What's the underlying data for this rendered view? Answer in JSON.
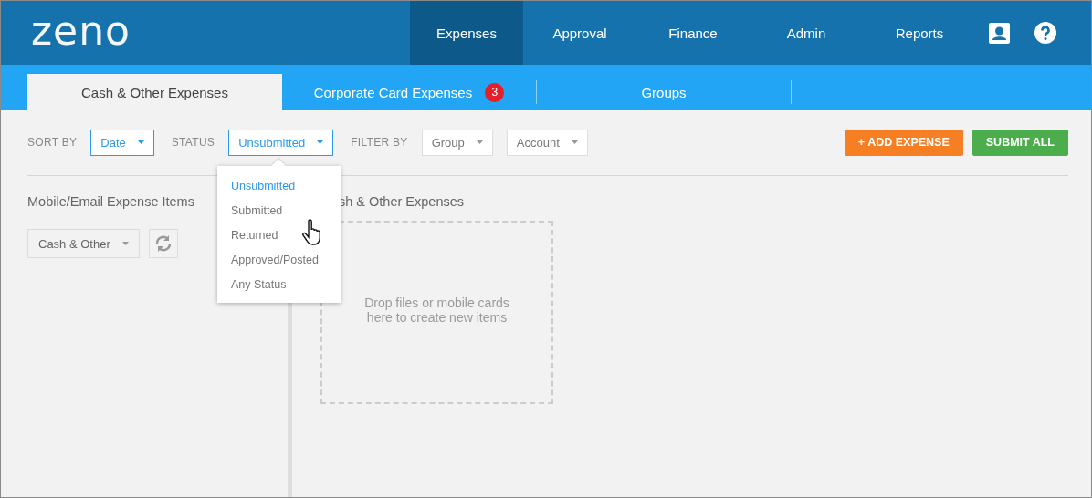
{
  "logo": "zeno",
  "nav": [
    {
      "label": "Expenses",
      "selected": true
    },
    {
      "label": "Approval",
      "selected": false
    },
    {
      "label": "Finance",
      "selected": false
    },
    {
      "label": "Admin",
      "selected": false
    },
    {
      "label": "Reports",
      "selected": false
    }
  ],
  "tabs": [
    {
      "label": "Cash & Other Expenses",
      "selected": true
    },
    {
      "label": "Corporate Card Expenses",
      "selected": false,
      "badge": "3"
    },
    {
      "label": "Groups",
      "selected": false
    }
  ],
  "toolbar": {
    "sort_label": "SORT BY",
    "sort_value": "Date",
    "status_label": "STATUS",
    "status_value": "Unsubmitted",
    "status_expanded": true,
    "filter_label": "FILTER BY",
    "filters": [
      "Group",
      "Account"
    ],
    "buttons": [
      {
        "label": "+ ADD EXPENSE",
        "kind": "add"
      },
      {
        "label": "SUBMIT ALL",
        "kind": "submit"
      }
    ]
  },
  "status_menu": [
    {
      "label": "Unsubmitted",
      "selected": true
    },
    {
      "label": "Submitted",
      "selected": false
    },
    {
      "label": "Returned",
      "selected": false
    },
    {
      "label": "Approved/Posted",
      "selected": false
    },
    {
      "label": "Any Status",
      "selected": false
    }
  ],
  "left_panel": {
    "title": "Mobile/Email Expense Items",
    "select": "Cash & Other"
  },
  "right_panel": {
    "title": "sh & Other Expenses",
    "drop_zone": "Drop files or mobile cards\nhere to create new items"
  }
}
